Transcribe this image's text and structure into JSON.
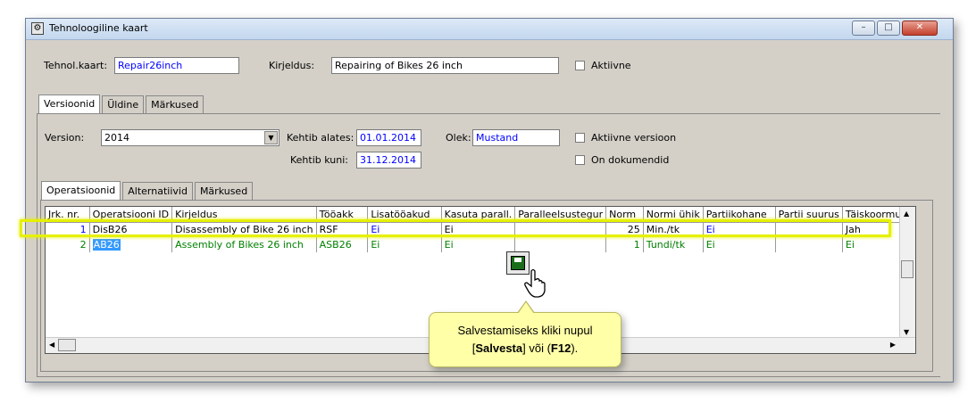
{
  "window": {
    "title": "Tehnoloogiline kaart",
    "min": "–",
    "max": "□",
    "close": "✕"
  },
  "header": {
    "tehnol_label": "Tehnol.kaart:",
    "tehnol_value": "Repair26inch",
    "kirjeldus_label": "Kirjeldus:",
    "kirjeldus_value": "Repairing of Bikes 26 inch",
    "aktiivne_label": "Aktiivne"
  },
  "tabs_top": [
    "Versioonid",
    "Üldine",
    "Märkused"
  ],
  "version": {
    "version_label": "Version:",
    "version_value": "2014",
    "kehtib_alates_label": "Kehtib alates:",
    "kehtib_alates_value": "01.01.2014",
    "kehtib_kuni_label": "Kehtib kuni:",
    "kehtib_kuni_value": "31.12.2014",
    "olek_label": "Olek:",
    "olek_value": "Mustand",
    "aktiivne_versioon_label": "Aktiivne versioon",
    "on_dokumendid_label": "On dokumendid"
  },
  "tabs_inner": [
    "Operatsioonid",
    "Alternatiivid",
    "Märkused"
  ],
  "grid": {
    "columns": [
      "Jrk. nr.",
      "Operatsiooni ID",
      "Kirjeldus",
      "Tööakk",
      "Lisatööakud",
      "Kasuta parall.",
      "Paralleelsustegur",
      "Norm",
      "Normi ühik",
      "Partiikohane",
      "Partii suurus",
      "Täiskoormus"
    ],
    "rows": [
      [
        "1",
        "DisB26",
        "Disassembly of Bike 26 inch",
        "RSF",
        "Ei",
        "Ei",
        "",
        "25",
        "Min./tk",
        "Ei",
        "",
        "Jah"
      ],
      [
        "2",
        "AB26",
        "Assembly of Bikes 26 inch",
        "ASB26",
        "Ei",
        "Ei",
        "",
        "1",
        "Tundi/tk",
        "Ei",
        "",
        "Ei"
      ]
    ]
  },
  "tooltip": {
    "line1": "Salvestamiseks kliki nupul",
    "open": "[",
    "bold1": "Salvesta",
    "mid": "] või (",
    "bold2": "F12",
    "close": ")."
  },
  "colors": {
    "highlight": "#e6f000",
    "tooltip_bg": "#ffffa8",
    "link_blue": "#0000ff",
    "selected_green": "#008000"
  }
}
